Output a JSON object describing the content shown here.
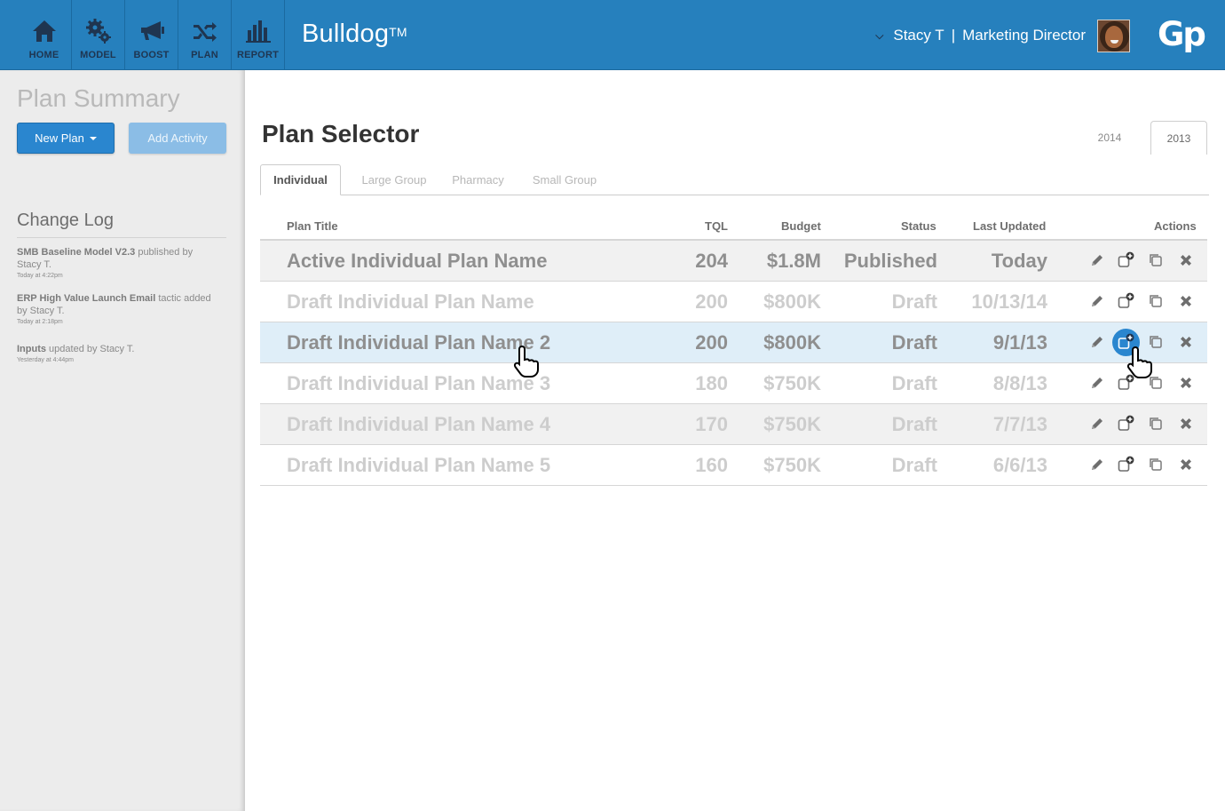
{
  "nav": {
    "items": [
      {
        "label": "HOME",
        "icon": "home-icon"
      },
      {
        "label": "MODEL",
        "icon": "gears-icon"
      },
      {
        "label": "BOOST",
        "icon": "megaphone-icon"
      },
      {
        "label": "PLAN",
        "icon": "shuffle-icon"
      },
      {
        "label": "REPORT",
        "icon": "bar-chart-icon"
      }
    ]
  },
  "app": {
    "name": "Bulldog",
    "trademark": "TM",
    "logo": "Gp"
  },
  "user": {
    "name": "Stacy T",
    "separator": "|",
    "role": "Marketing Director"
  },
  "sidebar": {
    "title": "Plan Summary",
    "new_plan_label": "New Plan",
    "add_activity_label": "Add Activity",
    "changelog_title": "Change Log",
    "log": [
      {
        "bold": "SMB Baseline Model V2.3",
        "text": " published by Stacy T.",
        "time": "Today at 4:22pm"
      },
      {
        "bold": "ERP High Value Launch Email",
        "text": " tactic added by Stacy T.",
        "time": "Today at 2:18pm"
      },
      {
        "bold": "Inputs",
        "text": " updated by Stacy T.",
        "time": "Yesterday at 4:44pm"
      }
    ]
  },
  "main": {
    "title": "Plan Selector",
    "years": [
      "2014",
      "2013"
    ],
    "active_year": "2013",
    "tabs": [
      "Individual",
      "Large Group",
      "Pharmacy",
      "Small Group"
    ],
    "active_tab": "Individual",
    "columns": {
      "title": "Plan Title",
      "tql": "TQL",
      "budget": "Budget",
      "status": "Status",
      "updated": "Last Updated",
      "actions": "Actions"
    },
    "rows": [
      {
        "title": "Active Individual Plan Name",
        "tql": "204",
        "budget": "$1.8M",
        "status": "Published",
        "updated": "Today"
      },
      {
        "title": "Draft Individual Plan Name",
        "tql": "200",
        "budget": "$800K",
        "status": "Draft",
        "updated": "10/13/14"
      },
      {
        "title": "Draft Individual Plan Name 2",
        "tql": "200",
        "budget": "$800K",
        "status": "Draft",
        "updated": "9/1/13"
      },
      {
        "title": "Draft Individual Plan Name 3",
        "tql": "180",
        "budget": "$750K",
        "status": "Draft",
        "updated": "8/8/13"
      },
      {
        "title": "Draft Individual Plan Name 4",
        "tql": "170",
        "budget": "$750K",
        "status": "Draft",
        "updated": "7/7/13"
      },
      {
        "title": "Draft Individual Plan Name 5",
        "tql": "160",
        "budget": "$750K",
        "status": "Draft",
        "updated": "6/6/13"
      }
    ],
    "row_actions": [
      "pencil-icon",
      "new-from-plan-icon",
      "duplicate-icon",
      "close-icon"
    ]
  },
  "colors": {
    "accent": "#2680bd",
    "button": "#2a86cf",
    "row_highlight": "#dfeef8",
    "nav_icon": "#1f3550"
  }
}
